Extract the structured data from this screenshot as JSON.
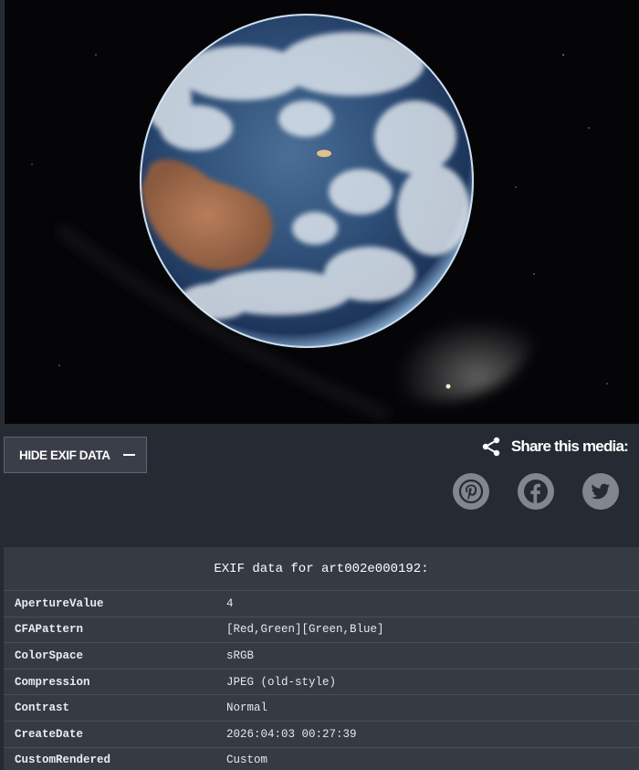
{
  "media": {
    "image_description": "Earth photographed from space showing Australia",
    "icon": "earth-photo"
  },
  "toolbar": {
    "exif_toggle_label": "HIDE EXIF DATA",
    "share_label": "Share this media:",
    "share_icon": "share-icon",
    "social": [
      {
        "name": "pinterest",
        "icon": "pinterest-icon"
      },
      {
        "name": "facebook",
        "icon": "facebook-icon"
      },
      {
        "name": "twitter",
        "icon": "twitter-icon"
      }
    ]
  },
  "exif": {
    "title": "EXIF data for art002e000192:",
    "rows": [
      {
        "key": "ApertureValue",
        "value": "4"
      },
      {
        "key": "CFAPattern",
        "value": "[Red,Green][Green,Blue]"
      },
      {
        "key": "ColorSpace",
        "value": "sRGB"
      },
      {
        "key": "Compression",
        "value": "JPEG (old-style)"
      },
      {
        "key": "Contrast",
        "value": "Normal"
      },
      {
        "key": "CreateDate",
        "value": "2026:04:03 00:27:39"
      },
      {
        "key": "CustomRendered",
        "value": "Custom"
      }
    ]
  },
  "colors": {
    "page_bg": "#262a33",
    "button_bg": "#3a3e48",
    "social_bg": "#82868e",
    "table_bg": "#363a43"
  }
}
